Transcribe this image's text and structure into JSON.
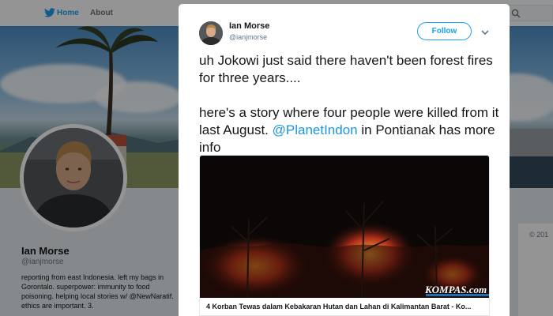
{
  "nav": {
    "home_label": "Home",
    "about_label": "About"
  },
  "profile": {
    "name": "Ian Morse",
    "handle": "@ianjmorse",
    "bio": "reporting from east Indonesia. left my bags in Gorontalo. superpower: immunity to food poisoning. helping local stories w/ @NewNaratif. ethics are important. 3.",
    "copyright": "© 201"
  },
  "tweet": {
    "author_name": "Ian Morse",
    "author_handle": "@ianjmorse",
    "follow_label": "Follow",
    "line1": "uh Jokowi just said there haven't been forest fires for three years....",
    "line2_prefix": "here's a story where four people were killed from it last August. ",
    "mention": "@PlanetIndon",
    "line2_suffix": " in Pontianak has more info"
  },
  "card": {
    "title": "4 Korban Tewas dalam Kebakaran Hutan dan Lahan di Kalimantan Barat - Ko...",
    "watermark": "KOMPAS.com"
  },
  "colors": {
    "accent": "#1da1f2",
    "mention": "#1b95e0",
    "text": "#14171a",
    "muted": "#657786"
  },
  "icons": [
    "twitter-bird-icon",
    "search-icon",
    "chevron-down-icon"
  ]
}
